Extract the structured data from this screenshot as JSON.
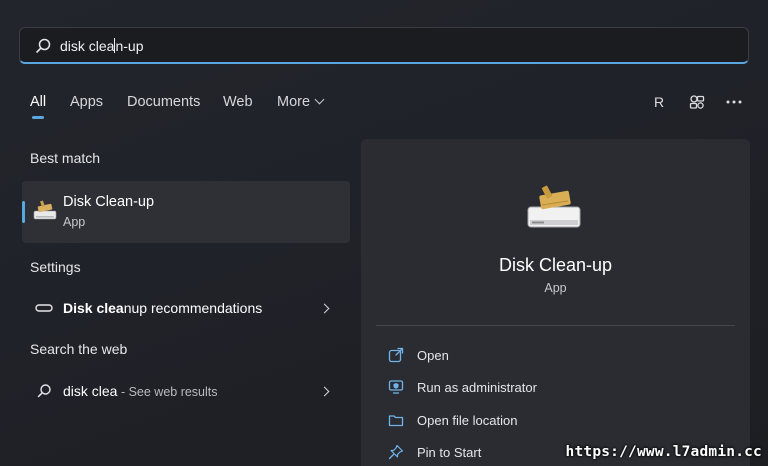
{
  "search": {
    "value_before_caret": "disk clea",
    "value_after_caret": "n-up"
  },
  "tabs": [
    {
      "label": "All",
      "active": true
    },
    {
      "label": "Apps"
    },
    {
      "label": "Documents"
    },
    {
      "label": "Web"
    },
    {
      "label": "More"
    }
  ],
  "account": {
    "initial": "R"
  },
  "toolbar_icons": [
    "profile-initial-icon",
    "connected-devices-icon",
    "more-options-icon"
  ],
  "best_match": {
    "section_title": "Best match",
    "name": "Disk Clean-up",
    "type": "App",
    "icon": "disk-cleanup-icon"
  },
  "settings": {
    "section_title": "Settings",
    "item": {
      "bold": "Disk clea",
      "rest": "nup recommendations",
      "icon": "storage-drive-icon"
    }
  },
  "web": {
    "section_title": "Search the web",
    "item": {
      "query": "disk clea",
      "suffix": " - See web results",
      "icon": "search-icon"
    }
  },
  "preview": {
    "title": "Disk Clean-up",
    "subtitle": "App",
    "actions": [
      {
        "label": "Open",
        "icon": "open-icon"
      },
      {
        "label": "Run as administrator",
        "icon": "shield-admin-icon"
      },
      {
        "label": "Open file location",
        "icon": "folder-icon"
      },
      {
        "label": "Pin to Start",
        "icon": "pin-icon"
      }
    ]
  },
  "watermark": "https://www.l7admin.cc",
  "colors": {
    "accent": "#5aa7e0",
    "background": "#202229",
    "panel": "#2a2c31"
  }
}
